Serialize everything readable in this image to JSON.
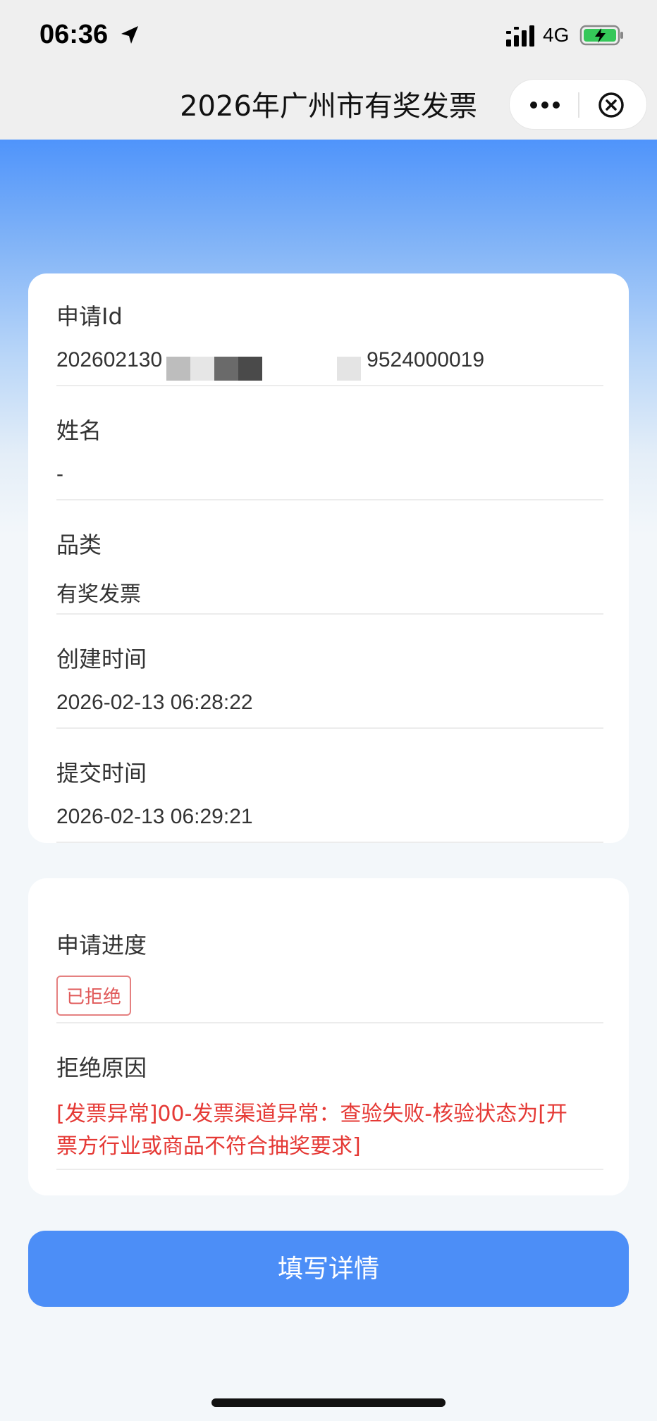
{
  "status_bar": {
    "time": "06:36",
    "network": "4G",
    "icons": [
      "location-arrow-icon",
      "signal-icon",
      "battery-charging-icon"
    ]
  },
  "nav": {
    "title": "2026年广州市有奖发票",
    "icons": [
      "more-icon",
      "close-circle-icon"
    ]
  },
  "info_card": {
    "fields": [
      {
        "label": "申请Id",
        "value": "202602130",
        "value_tail": "9524000019"
      },
      {
        "label": "姓名",
        "value": "-"
      },
      {
        "label": "品类",
        "value": "有奖发票"
      },
      {
        "label": "创建时间",
        "value": "2026-02-13 06:28:22"
      },
      {
        "label": "提交时间",
        "value": "2026-02-13 06:29:21"
      }
    ]
  },
  "progress_card": {
    "progress_label": "申请进度",
    "status": "已拒绝",
    "reason_label": "拒绝原因",
    "reason_line1": "[发票异常]00-发票渠道异常：查验失败-核验状态为[开",
    "reason_line2": "票方行业或商品不符合抽奖要求]"
  },
  "actions": {
    "fill_details": "填写详情"
  },
  "colors": {
    "primary": "#4c8ef7",
    "danger": "#e53935",
    "tag_border": "#e58080"
  }
}
